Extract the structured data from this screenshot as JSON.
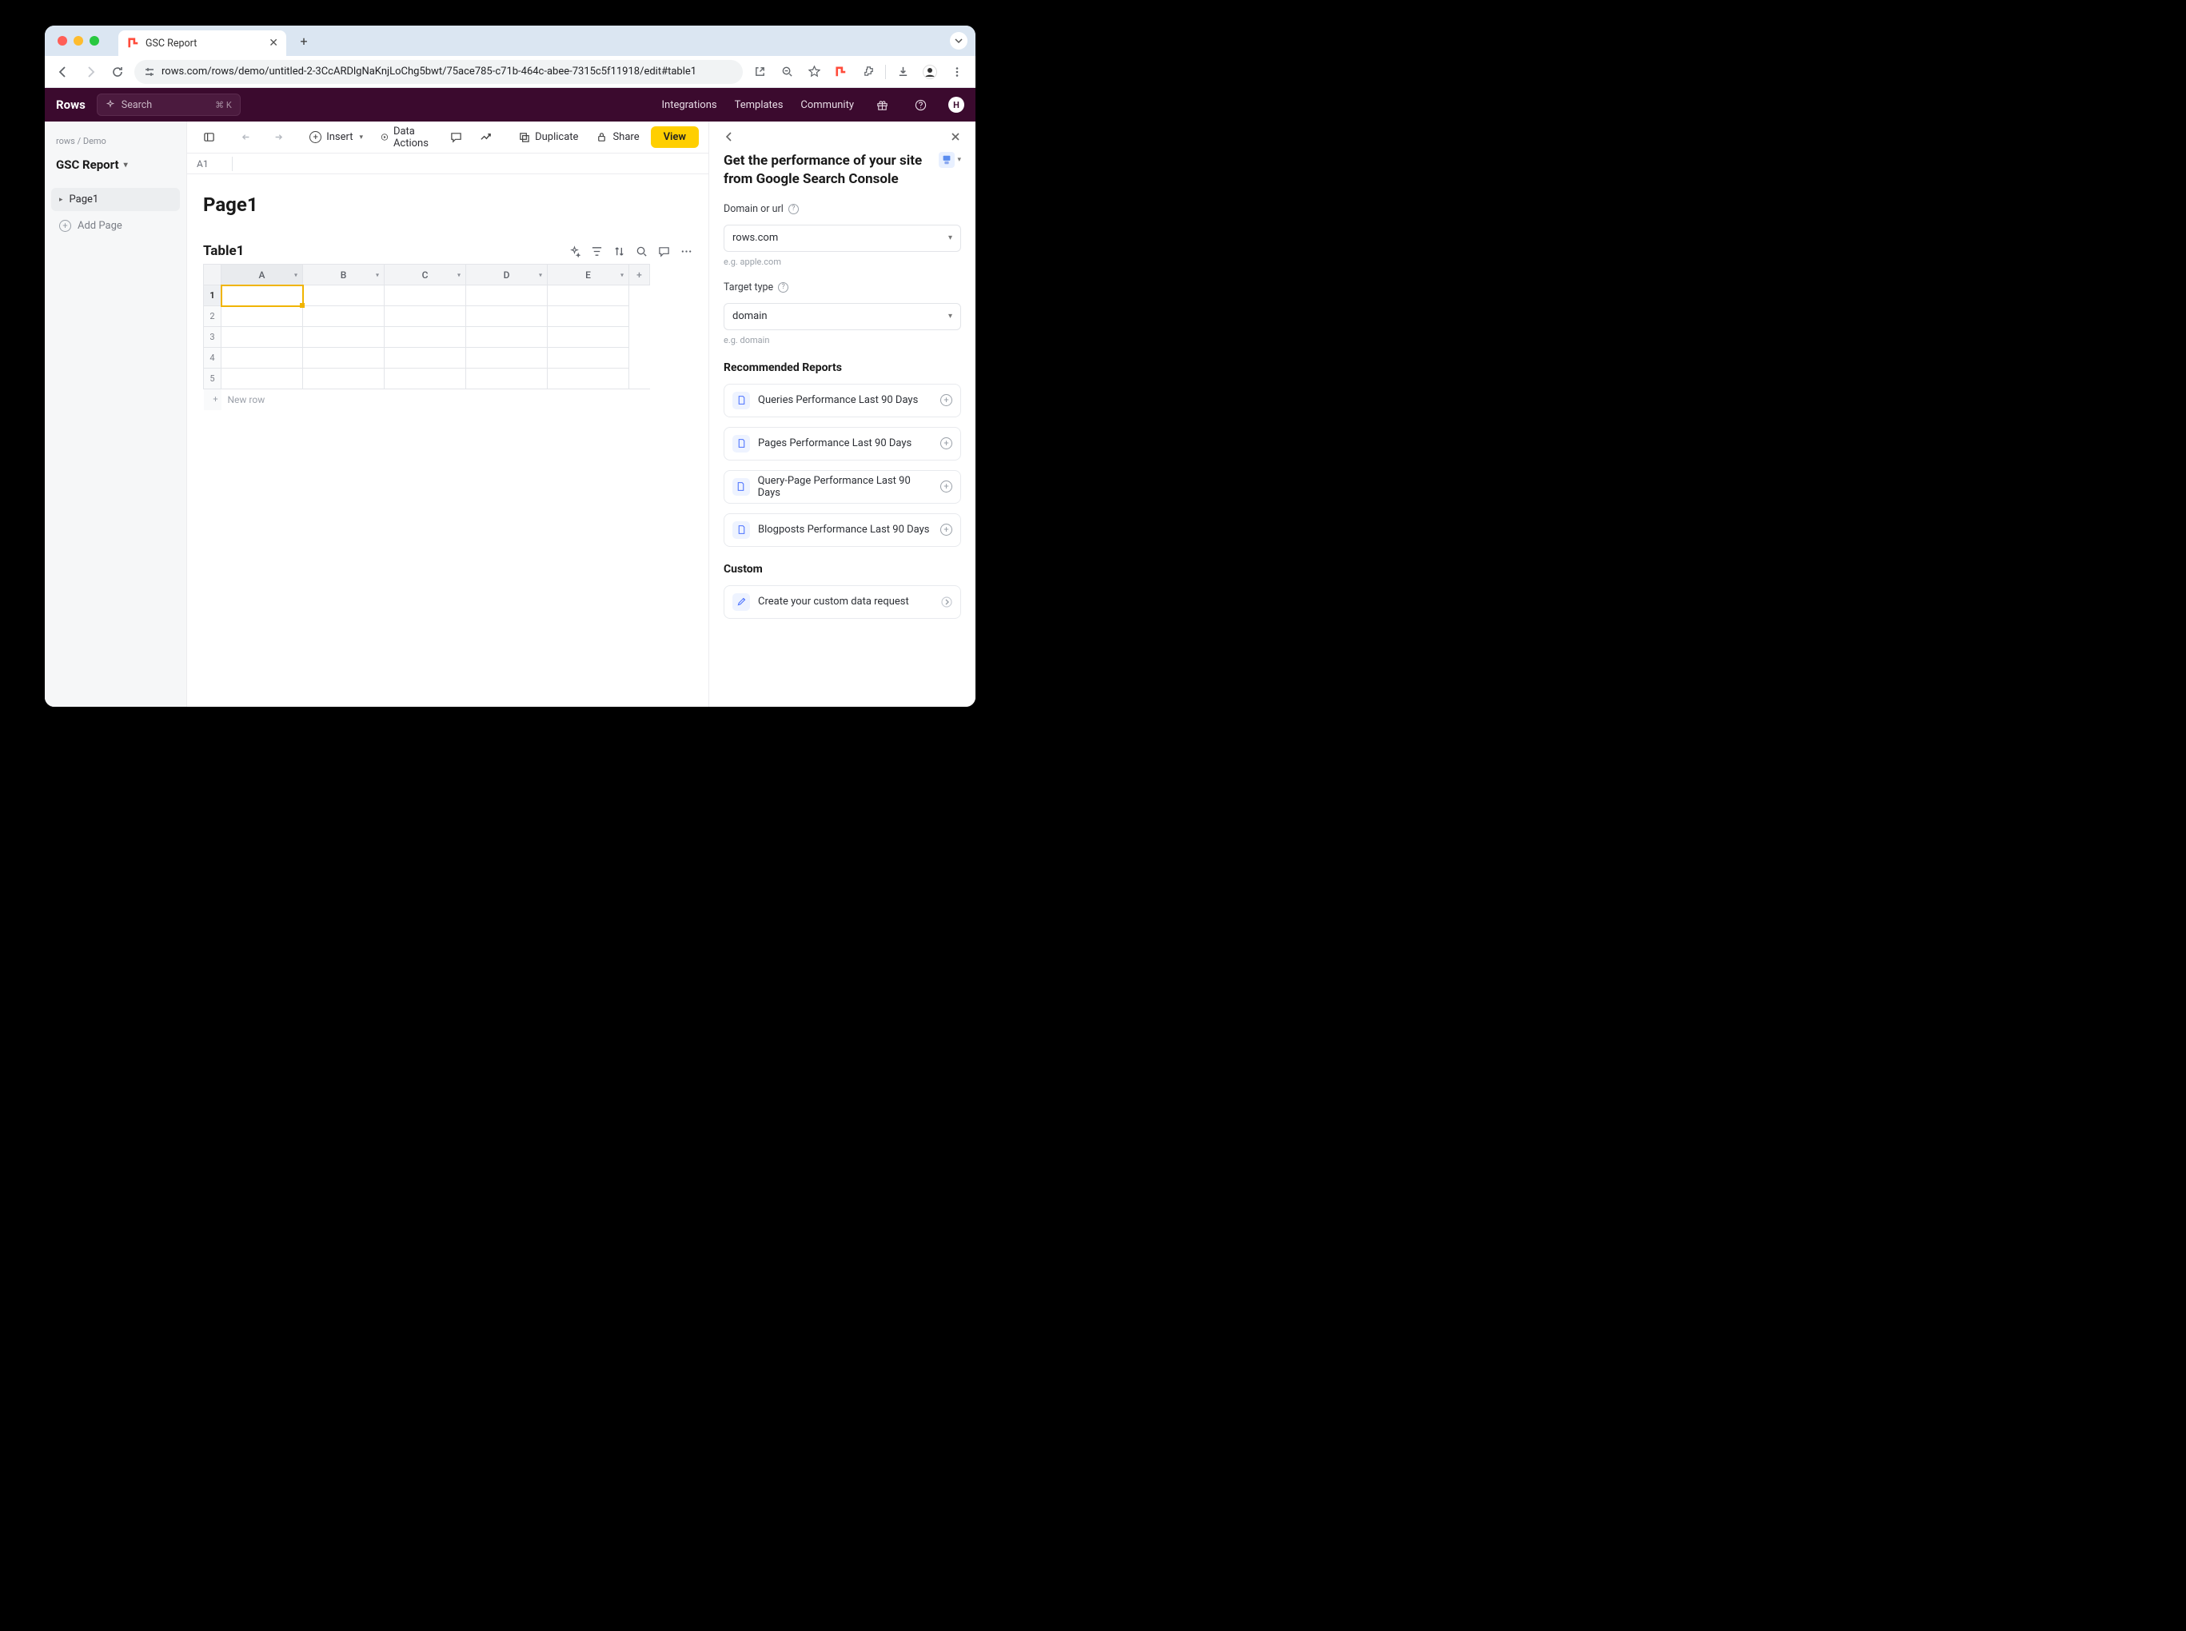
{
  "browser": {
    "tab_title": "GSC Report",
    "url": "rows.com/rows/demo/untitled-2-3CcARDlgNaKnjLoChg5bwt/75ace785-c71b-464c-abee-7315c5f11918/edit#table1"
  },
  "appbar": {
    "logo": "Rows",
    "search_placeholder": "Search",
    "search_shortcut": "⌘ K",
    "links": {
      "integrations": "Integrations",
      "templates": "Templates",
      "community": "Community"
    },
    "avatar_initial": "H"
  },
  "sidebar": {
    "crumb_root": "rows",
    "crumb_folder": "Demo",
    "doc_title": "GSC Report",
    "page1": "Page1",
    "add_page": "Add Page"
  },
  "toolbar": {
    "insert": "Insert",
    "data_actions": "Data Actions",
    "duplicate": "Duplicate",
    "share": "Share",
    "view": "View"
  },
  "formula_bar": {
    "cell_ref": "A1"
  },
  "page": {
    "title": "Page1",
    "table_title": "Table1",
    "new_row": "New row",
    "columns": [
      "A",
      "B",
      "C",
      "D",
      "E"
    ],
    "rows": [
      "1",
      "2",
      "3",
      "4",
      "5"
    ]
  },
  "panel": {
    "title": "Get the performance of your site from Google Search Console",
    "domain_label": "Domain or url",
    "domain_value": "rows.com",
    "domain_hint": "e.g. apple.com",
    "target_label": "Target type",
    "target_value": "domain",
    "target_hint": "e.g. domain",
    "recommended_heading": "Recommended Reports",
    "reports": [
      "Queries Performance Last 90 Days",
      "Pages Performance Last 90 Days",
      "Query-Page Performance Last 90 Days",
      "Blogposts Performance Last 90 Days"
    ],
    "custom_heading": "Custom",
    "custom_item": "Create your custom data request"
  }
}
